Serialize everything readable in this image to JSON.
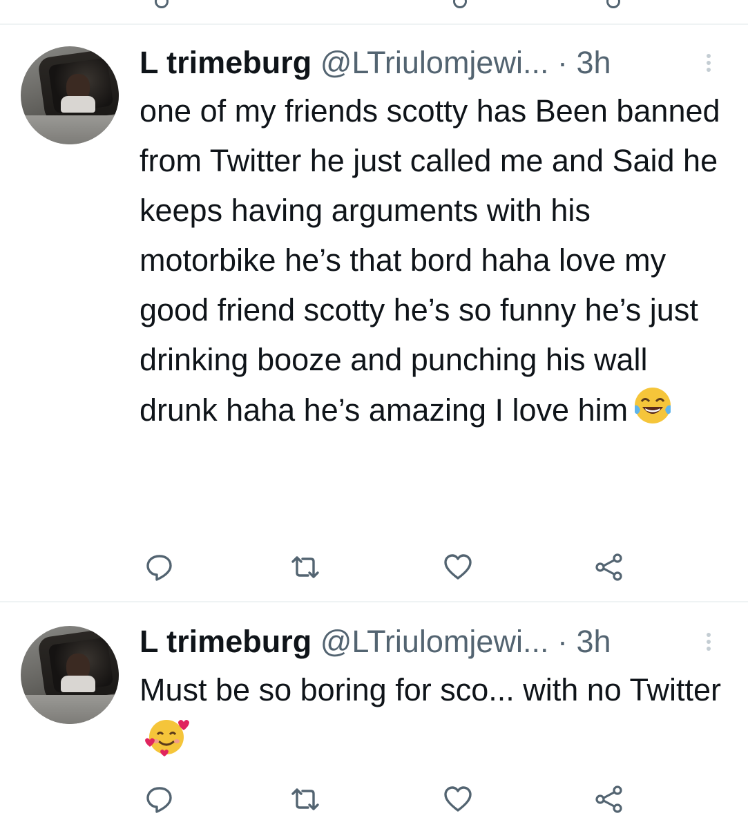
{
  "tweets": [
    {
      "name": "L trimeburg",
      "handle": "@LTriulomjewi...",
      "dot": "·",
      "time": "3h",
      "text": "one of my friends scotty has Been banned from Twitter he just called me and Said he keeps having arguments with his motorbike he’s that bord haha love my good friend scotty he’s so funny he’s just drinking booze and punching his wall drunk haha he’s amazing I love him",
      "emoji": "face-with-tears-of-joy"
    },
    {
      "name": "L trimeburg",
      "handle": "@LTriulomjewi...",
      "dot": "·",
      "time": "3h",
      "text": "Must be so boring for sco... with no Twitter",
      "emoji": "smiling-face-with-hearts"
    }
  ],
  "icons": {
    "reply": "reply-icon",
    "retweet": "retweet-icon",
    "like": "like-icon",
    "share": "share-icon",
    "more": "more-icon"
  },
  "colors": {
    "text": "#0f1419",
    "secondary": "#536471",
    "divider": "#eff3f4"
  }
}
